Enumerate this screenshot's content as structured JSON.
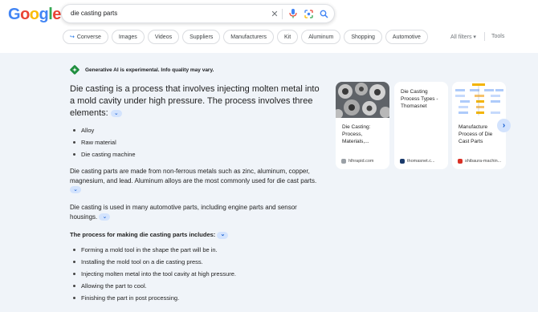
{
  "logo": {
    "letters": [
      "G",
      "o",
      "o",
      "g",
      "l",
      "e"
    ],
    "colors": [
      "#4285f4",
      "#ea4335",
      "#fbbc05",
      "#4285f4",
      "#34a853",
      "#ea4335"
    ]
  },
  "search": {
    "query": "die casting parts"
  },
  "chips": [
    {
      "label": "Converse",
      "icon": "converse-arrow-icon"
    },
    {
      "label": "Images"
    },
    {
      "label": "Videos"
    },
    {
      "label": "Suppliers"
    },
    {
      "label": "Manufacturers"
    },
    {
      "label": "Kit"
    },
    {
      "label": "Aluminum"
    },
    {
      "label": "Shopping"
    },
    {
      "label": "Automotive"
    }
  ],
  "filters": {
    "all_filters": "All filters",
    "tools": "Tools"
  },
  "ai": {
    "banner": "Generative AI is experimental. Info quality may vary.",
    "summary": "Die casting is a process that involves injecting molten metal into a mold cavity under high pressure. The process involves three elements:",
    "elements": [
      "Alloy",
      "Raw material",
      "Die casting machine"
    ],
    "para1": "Die casting parts are made from non-ferrous metals such as zinc, aluminum, copper, magnesium, and lead. Aluminum alloys are the most commonly used for die cast parts.",
    "para2": "Die casting is used in many automotive parts, including engine parts and sensor housings.",
    "process_heading": "The process for making die casting parts includes:",
    "steps": [
      "Forming a mold tool in the shape the part will be in.",
      "Installing the mold tool on a die casting press.",
      "Injecting molten metal into the tool cavity at high pressure.",
      "Allowing the part to cool.",
      "Finishing the part in post processing."
    ]
  },
  "sources": [
    {
      "title": "Die Casting: Process, Materials,...",
      "site": "hlhrapid.com"
    },
    {
      "title": "Die Casting Process Types - Thomasnet",
      "site": "thomasnet.c..."
    },
    {
      "title": "Manufacture Process of Die Cast Parts",
      "site": "shibaura-machin..."
    }
  ],
  "colors": {
    "accent": "#0b57d0",
    "chip_bg": "#d3e3fd",
    "main_bg": "#f0f4f9"
  }
}
